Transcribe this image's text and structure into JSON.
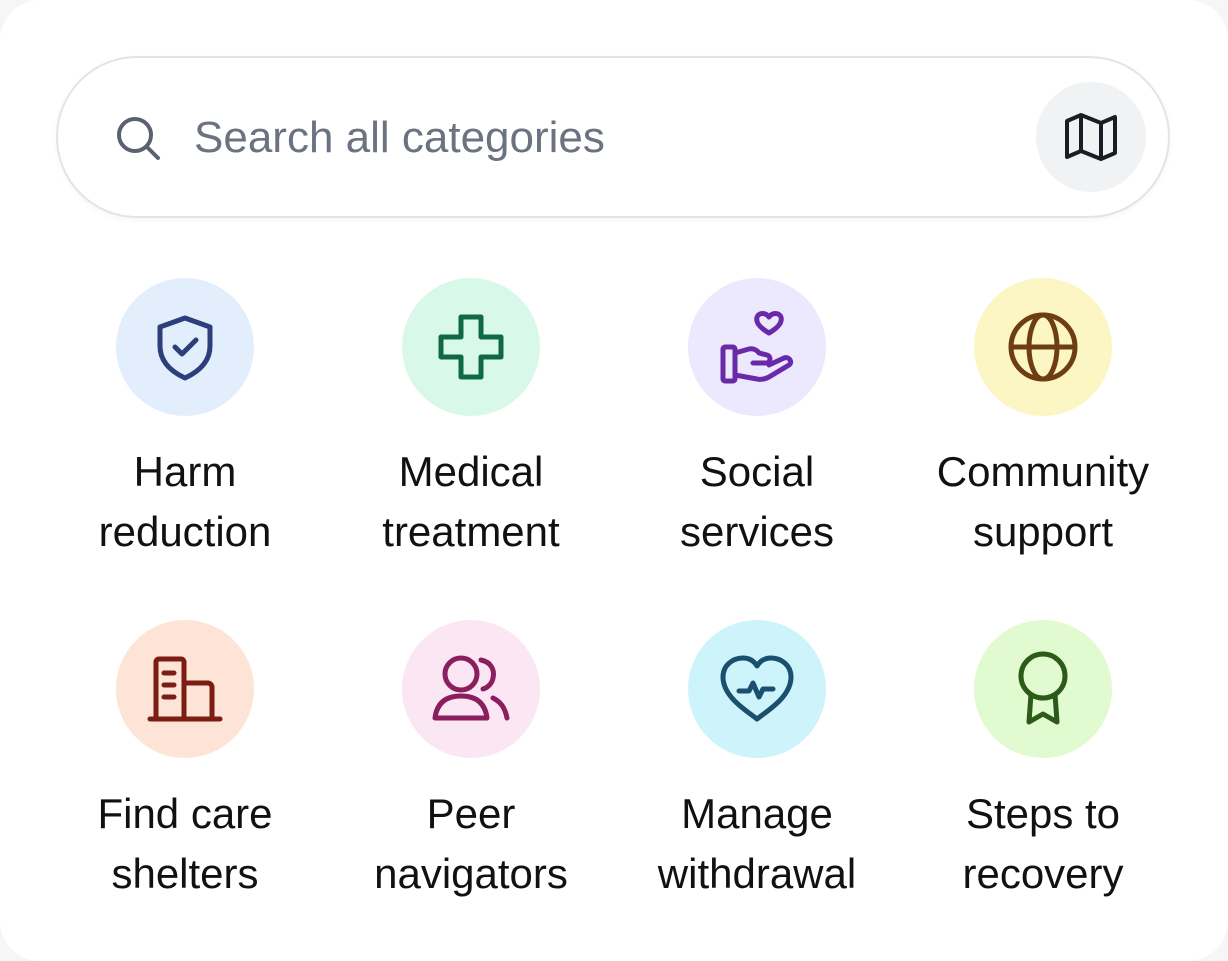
{
  "search": {
    "placeholder": "Search all categories",
    "value": "",
    "icon": "search-icon",
    "map_button_icon": "map-icon"
  },
  "categories": [
    {
      "id": "harm-reduction",
      "line1": "Harm",
      "line2": "reduction",
      "icon": "shield-check-icon",
      "bg": "#e3eefc",
      "fg": "#2c3f7a"
    },
    {
      "id": "medical-treatment",
      "line1": "Medical",
      "line2": "treatment",
      "icon": "medical-cross-icon",
      "bg": "#d8f8ea",
      "fg": "#0f6a43"
    },
    {
      "id": "social-services",
      "line1": "Social",
      "line2": "services",
      "icon": "hand-heart-icon",
      "bg": "#ece8fd",
      "fg": "#6a2aa8"
    },
    {
      "id": "community-support",
      "line1": "Community",
      "line2": "support",
      "icon": "globe-icon",
      "bg": "#fbf6c4",
      "fg": "#6e3e12"
    },
    {
      "id": "find-care-shelters",
      "line1": "Find care",
      "line2": "shelters",
      "icon": "building-icon",
      "bg": "#fde4d6",
      "fg": "#7c1d14"
    },
    {
      "id": "peer-navigators",
      "line1": "Peer",
      "line2": "navigators",
      "icon": "users-icon",
      "bg": "#fbe6f4",
      "fg": "#8a1e5e"
    },
    {
      "id": "manage-withdrawal",
      "line1": "Manage",
      "line2": "withdrawal",
      "icon": "heart-pulse-icon",
      "bg": "#cdf4fb",
      "fg": "#1b4f6e"
    },
    {
      "id": "steps-to-recovery",
      "line1": "Steps to",
      "line2": "recovery",
      "icon": "award-icon",
      "bg": "#e1fad0",
      "fg": "#2b5a19"
    }
  ]
}
